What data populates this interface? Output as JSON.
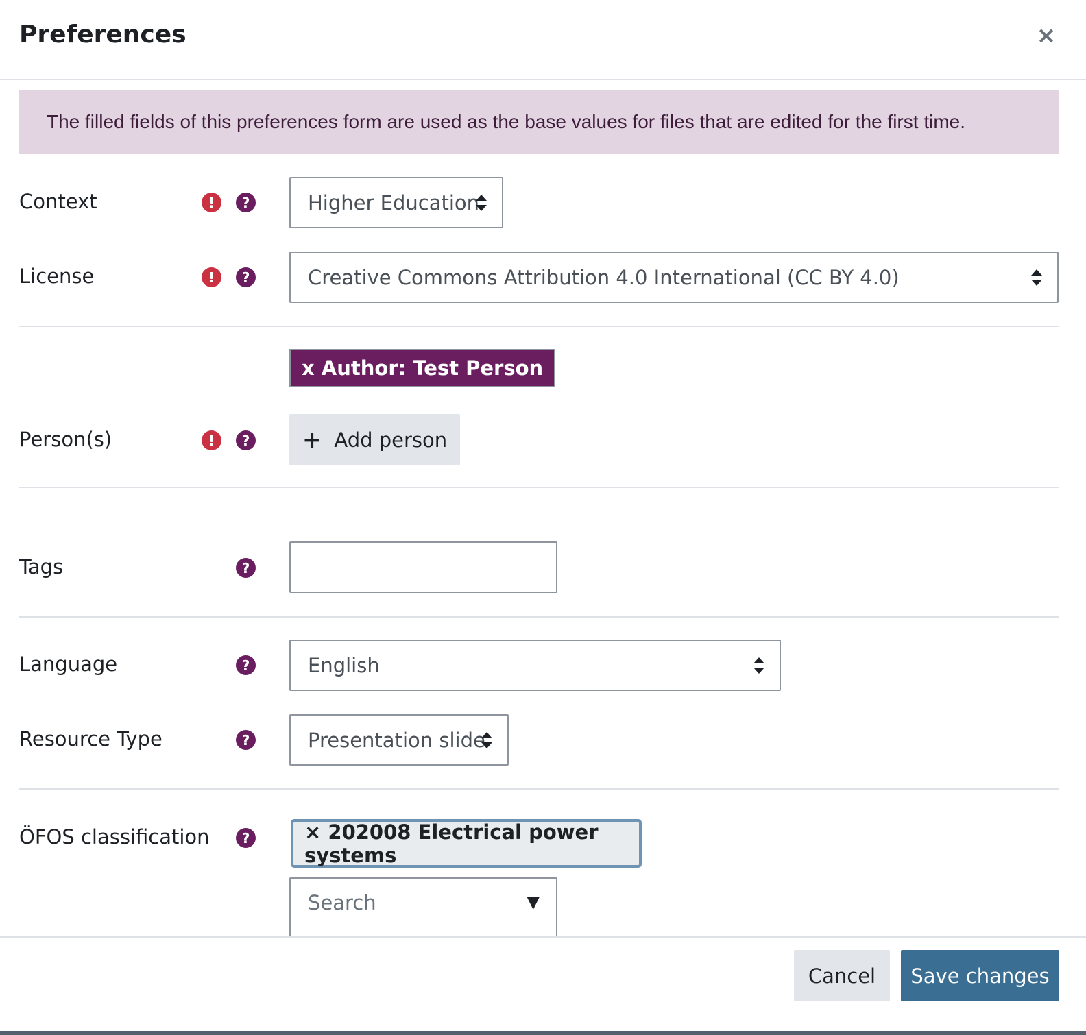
{
  "dialog": {
    "title": "Preferences",
    "close_label": "×"
  },
  "info": {
    "text": "The filled fields of this preferences form are used as the base values for files that are edited for the first time."
  },
  "icons": {
    "required_glyph": "!",
    "help_glyph": "?",
    "required_color": "#ca3141",
    "help_color": "#6a1e60"
  },
  "fields": {
    "context": {
      "label": "Context",
      "value": "Higher Education"
    },
    "license": {
      "label": "License",
      "value": "Creative Commons Attribution 4.0 International (CC BY 4.0)"
    },
    "persons": {
      "label": "Person(s)",
      "chip": "x Author: Test Person",
      "add_label": "Add person",
      "add_icon": "+"
    },
    "tags": {
      "label": "Tags",
      "value": ""
    },
    "language": {
      "label": "Language",
      "value": "English"
    },
    "resource_type": {
      "label": "Resource Type",
      "value": "Presentation slide"
    },
    "ofos": {
      "label": "ÖFOS classification",
      "chip": "× 202008 Electrical power systems",
      "search_placeholder": "Search",
      "search_arrow": "▼"
    }
  },
  "footer": {
    "cancel_label": "Cancel",
    "save_label": "Save changes"
  },
  "colors": {
    "accent": "#6a1e60",
    "primary": "#3b6e93",
    "info_bg": "#e2d4e1"
  }
}
